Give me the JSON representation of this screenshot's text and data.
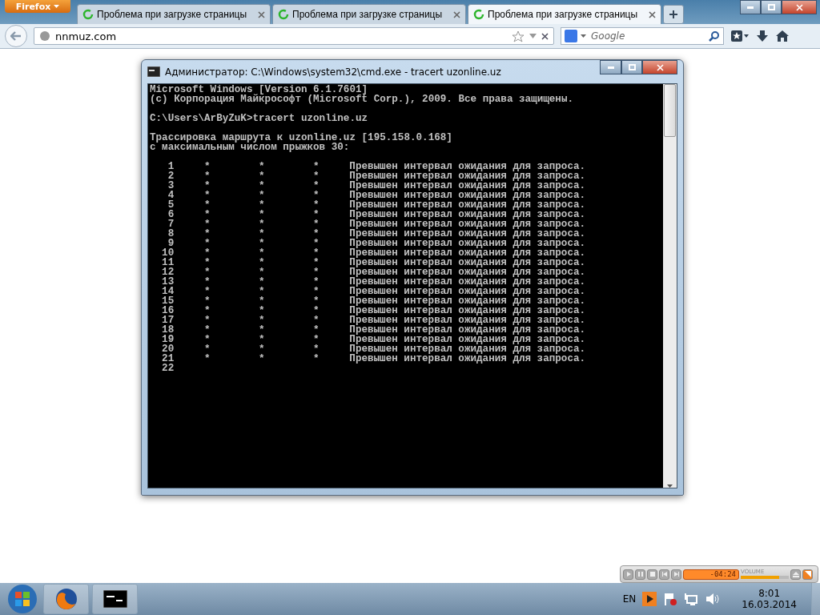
{
  "browser": {
    "menu_button": "Firefox",
    "tabs": [
      {
        "title": "Проблема при загрузке страницы",
        "selected": false
      },
      {
        "title": "Проблема при загрузке страницы",
        "selected": false
      },
      {
        "title": "Проблема при загрузке страницы",
        "selected": true
      }
    ],
    "address": "nnmuz.com",
    "search": {
      "placeholder": "Google"
    }
  },
  "console": {
    "title": "Администратор: C:\\Windows\\system32\\cmd.exe - tracert  uzonline.uz",
    "header_blocks": [
      [
        "Microsoft Windows [Version 6.1.7601]",
        "(c) Корпорация Майкрософт (Microsoft Corp.), 2009. Все права защищены."
      ],
      [
        "C:\\Users\\ArByZuK>tracert uzonline.uz"
      ],
      [
        "Трассировка маршрута к uzonline.uz [195.158.0.168]",
        "с максимальным числом прыжков 30:"
      ]
    ],
    "hops": [
      {
        "hop": "1",
        "probes": [
          "*",
          "*",
          "*"
        ],
        "message": "Превышен интервал ожидания для запроса."
      },
      {
        "hop": "2",
        "probes": [
          "*",
          "*",
          "*"
        ],
        "message": "Превышен интервал ожидания для запроса."
      },
      {
        "hop": "3",
        "probes": [
          "*",
          "*",
          "*"
        ],
        "message": "Превышен интервал ожидания для запроса."
      },
      {
        "hop": "4",
        "probes": [
          "*",
          "*",
          "*"
        ],
        "message": "Превышен интервал ожидания для запроса."
      },
      {
        "hop": "5",
        "probes": [
          "*",
          "*",
          "*"
        ],
        "message": "Превышен интервал ожидания для запроса."
      },
      {
        "hop": "6",
        "probes": [
          "*",
          "*",
          "*"
        ],
        "message": "Превышен интервал ожидания для запроса."
      },
      {
        "hop": "7",
        "probes": [
          "*",
          "*",
          "*"
        ],
        "message": "Превышен интервал ожидания для запроса."
      },
      {
        "hop": "8",
        "probes": [
          "*",
          "*",
          "*"
        ],
        "message": "Превышен интервал ожидания для запроса."
      },
      {
        "hop": "9",
        "probes": [
          "*",
          "*",
          "*"
        ],
        "message": "Превышен интервал ожидания для запроса."
      },
      {
        "hop": "10",
        "probes": [
          "*",
          "*",
          "*"
        ],
        "message": "Превышен интервал ожидания для запроса."
      },
      {
        "hop": "11",
        "probes": [
          "*",
          "*",
          "*"
        ],
        "message": "Превышен интервал ожидания для запроса."
      },
      {
        "hop": "12",
        "probes": [
          "*",
          "*",
          "*"
        ],
        "message": "Превышен интервал ожидания для запроса."
      },
      {
        "hop": "13",
        "probes": [
          "*",
          "*",
          "*"
        ],
        "message": "Превышен интервал ожидания для запроса."
      },
      {
        "hop": "14",
        "probes": [
          "*",
          "*",
          "*"
        ],
        "message": "Превышен интервал ожидания для запроса."
      },
      {
        "hop": "15",
        "probes": [
          "*",
          "*",
          "*"
        ],
        "message": "Превышен интервал ожидания для запроса."
      },
      {
        "hop": "16",
        "probes": [
          "*",
          "*",
          "*"
        ],
        "message": "Превышен интервал ожидания для запроса."
      },
      {
        "hop": "17",
        "probes": [
          "*",
          "*",
          "*"
        ],
        "message": "Превышен интервал ожидания для запроса."
      },
      {
        "hop": "18",
        "probes": [
          "*",
          "*",
          "*"
        ],
        "message": "Превышен интервал ожидания для запроса."
      },
      {
        "hop": "19",
        "probes": [
          "*",
          "*",
          "*"
        ],
        "message": "Превышен интервал ожидания для запроса."
      },
      {
        "hop": "20",
        "probes": [
          "*",
          "*",
          "*"
        ],
        "message": "Превышен интервал ожидания для запроса."
      },
      {
        "hop": "21",
        "probes": [
          "*",
          "*",
          "*"
        ],
        "message": "Превышен интервал ожидания для запроса."
      },
      {
        "hop": "22"
      }
    ]
  },
  "player": {
    "display": "-04:24",
    "volume_label": "VOLUME",
    "volume": {
      "level": 0.8
    }
  },
  "taskbar": {
    "language": "EN",
    "time": "8:01",
    "date": "16.03.2014"
  }
}
